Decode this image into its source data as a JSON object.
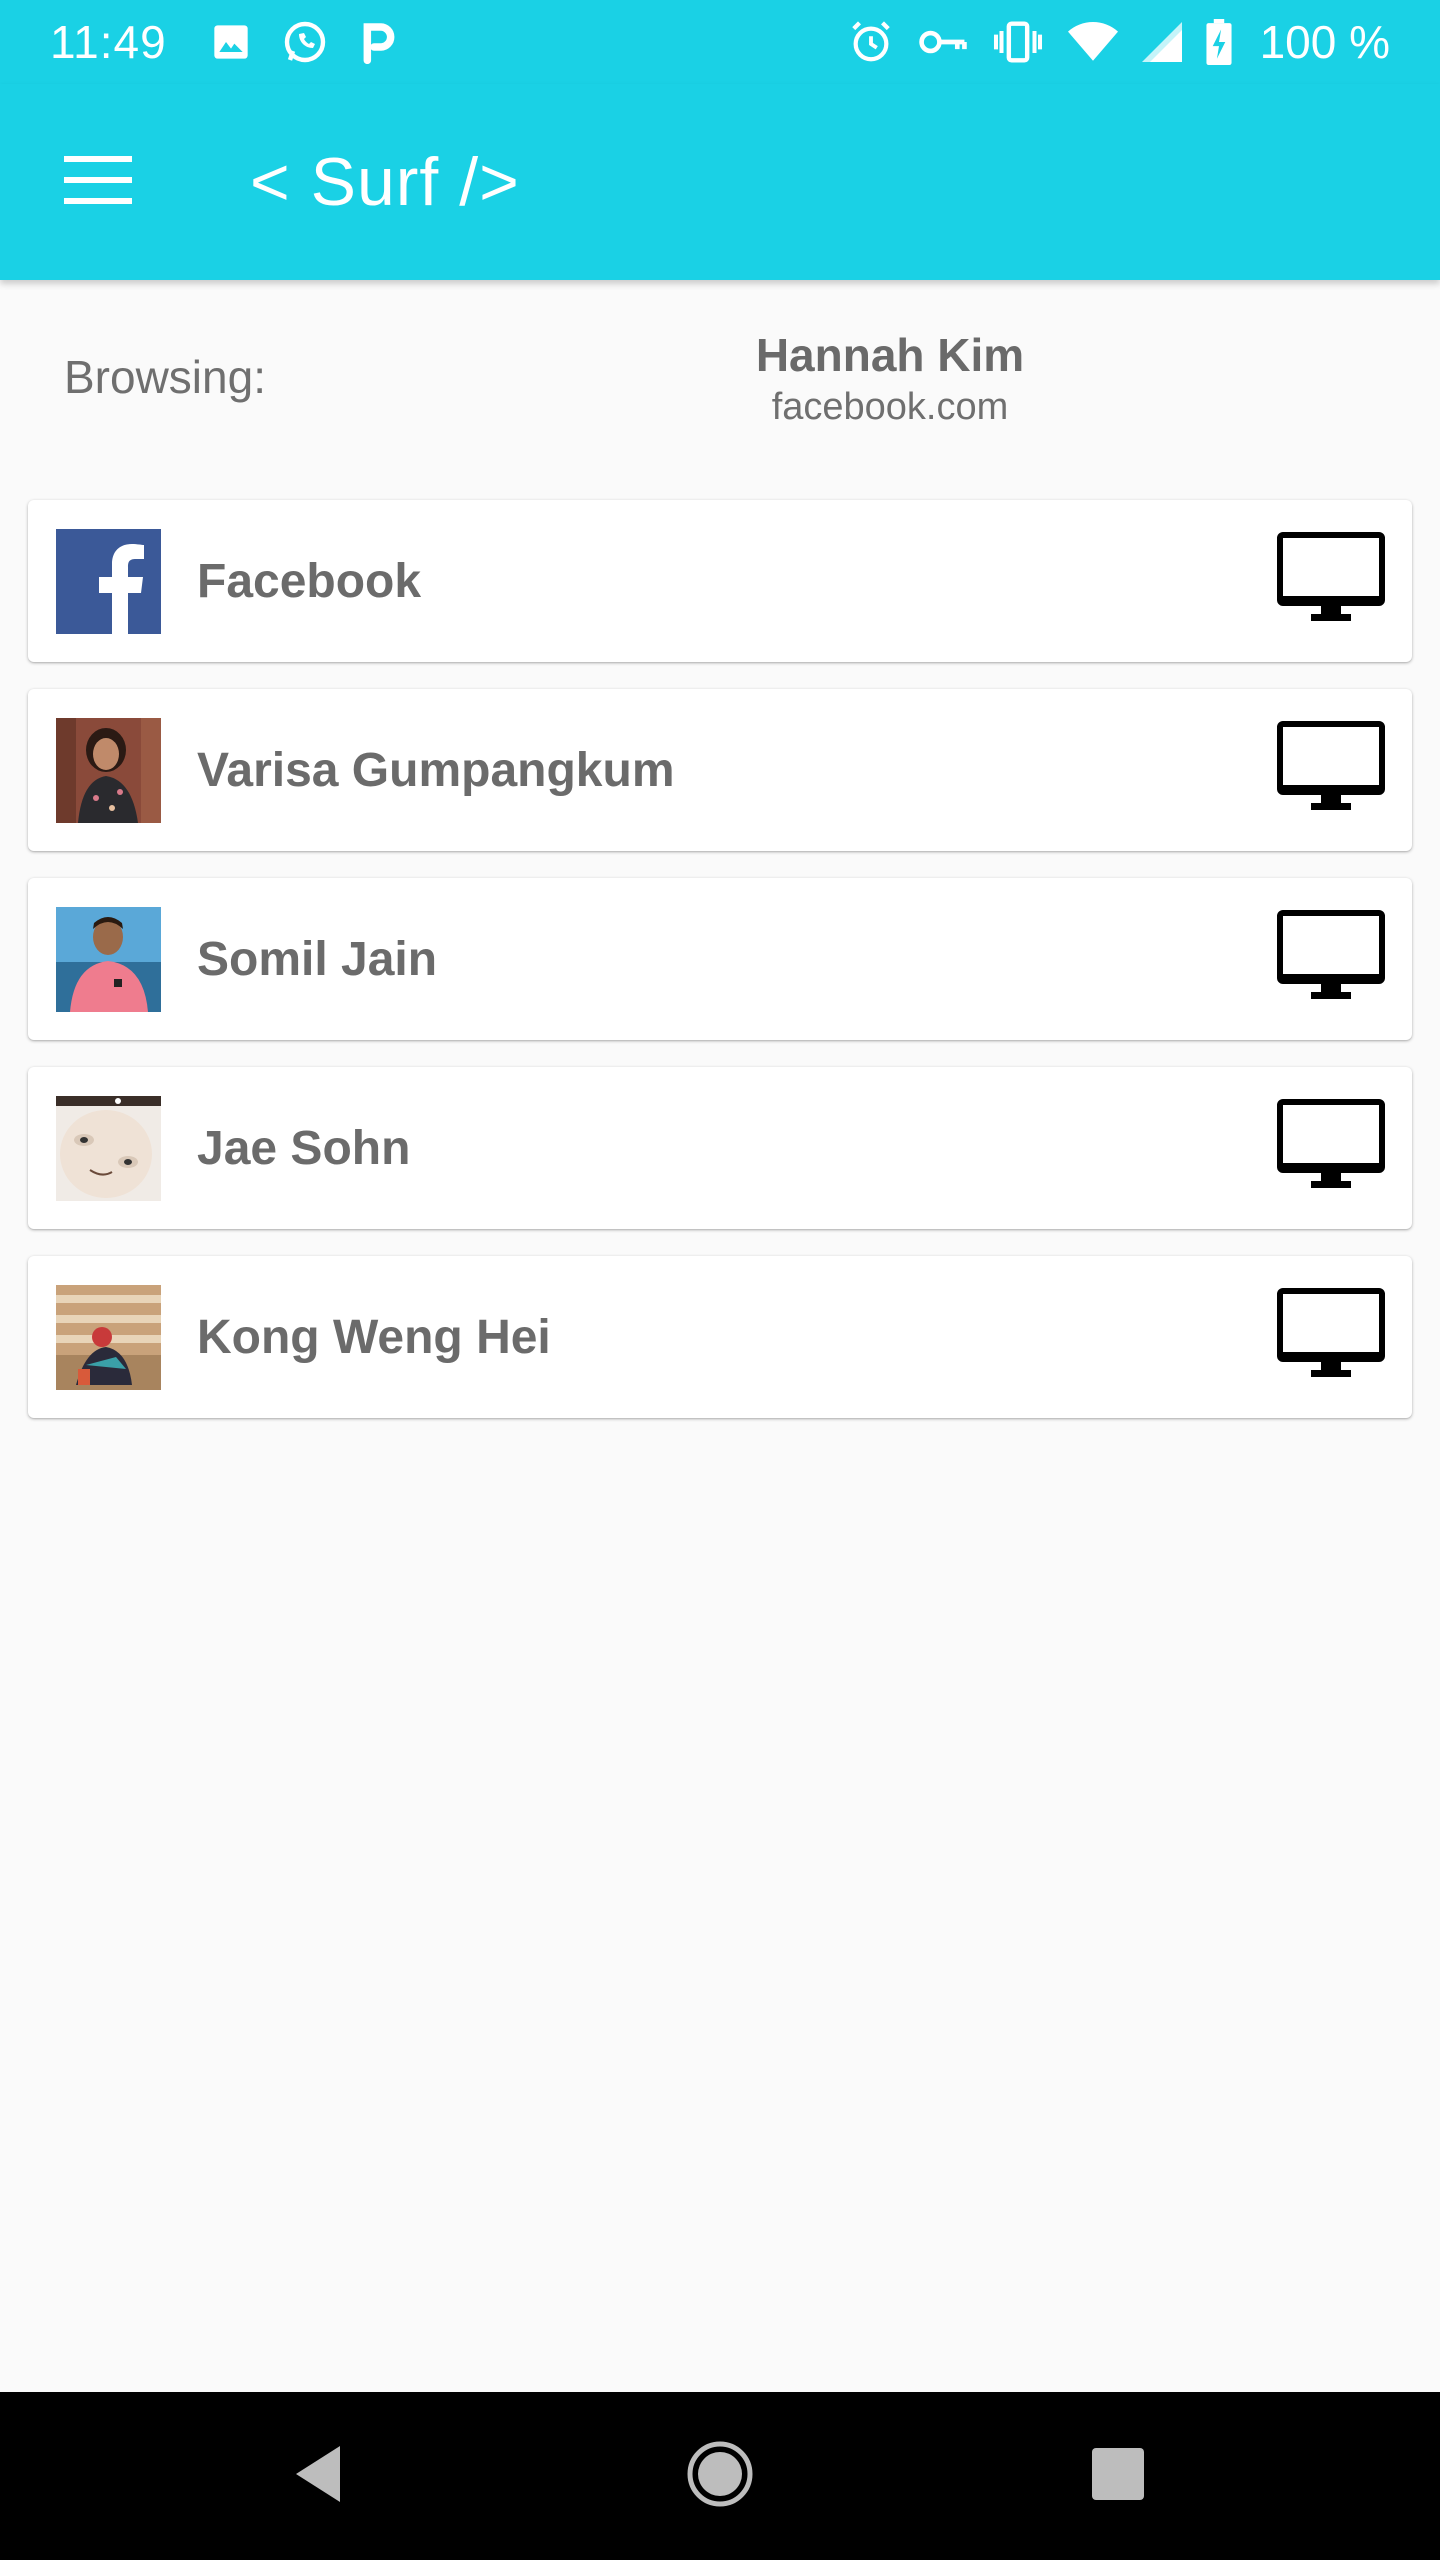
{
  "status": {
    "time": "11:49",
    "battery": "100 %",
    "left_icons": [
      "image-icon",
      "whatsapp-icon",
      "parking-icon"
    ],
    "right_icons": [
      "alarm-icon",
      "vpn-key-icon",
      "vibrate-icon",
      "wifi-icon",
      "cell-signal-icon",
      "battery-charging-icon"
    ]
  },
  "app_bar": {
    "title": "< Surf />",
    "menu_icon": "hamburger-menu-icon"
  },
  "browsing": {
    "label": "Browsing:",
    "user_name": "Hannah Kim",
    "site": "facebook.com"
  },
  "contacts": [
    {
      "name": "Facebook",
      "avatar": "facebook-logo",
      "action_icon": "monitor-icon"
    },
    {
      "name": "Varisa Gumpangkum",
      "avatar": "profile-photo",
      "action_icon": "monitor-icon"
    },
    {
      "name": "Somil Jain",
      "avatar": "profile-photo",
      "action_icon": "monitor-icon"
    },
    {
      "name": "Jae Sohn",
      "avatar": "profile-photo",
      "action_icon": "monitor-icon"
    },
    {
      "name": "Kong Weng Hei",
      "avatar": "profile-photo",
      "action_icon": "monitor-icon"
    }
  ],
  "nav": {
    "buttons": [
      "back-icon",
      "home-icon",
      "recents-icon"
    ]
  },
  "colors": {
    "primary": "#1ad1e5",
    "text_gray": "#6b6b6b",
    "facebook_blue": "#3b5998"
  }
}
